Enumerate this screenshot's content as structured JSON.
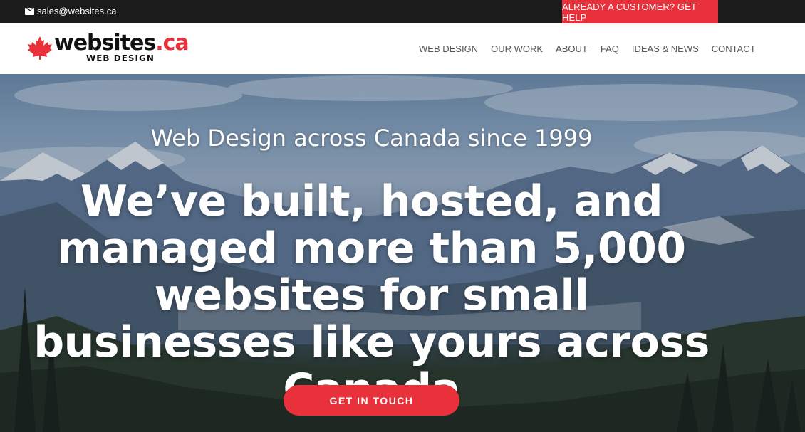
{
  "topbar": {
    "email": "sales@websites.ca",
    "email_icon": "envelope-icon",
    "customer_help": "ALREADY A CUSTOMER? GET HELP"
  },
  "header": {
    "logo": {
      "name_main": "websites",
      "name_tld": ".ca",
      "subtitle": "WEB DESIGN",
      "icon": "maple-leaf-icon"
    },
    "nav": [
      {
        "label": "WEB DESIGN"
      },
      {
        "label": "OUR WORK"
      },
      {
        "label": "ABOUT"
      },
      {
        "label": "FAQ"
      },
      {
        "label": "IDEAS & NEWS"
      },
      {
        "label": "CONTACT"
      }
    ]
  },
  "hero": {
    "tagline": "Web Design across Canada since 1999",
    "headline": "We’ve built, hosted, and managed more than 5,000 websites for small businesses like yours across Canada",
    "cta": "GET IN TOUCH"
  },
  "colors": {
    "accent": "#e8313a",
    "topbar_bg": "#1b1b1b",
    "header_bg": "#ffffff",
    "nav_text": "#555555"
  }
}
